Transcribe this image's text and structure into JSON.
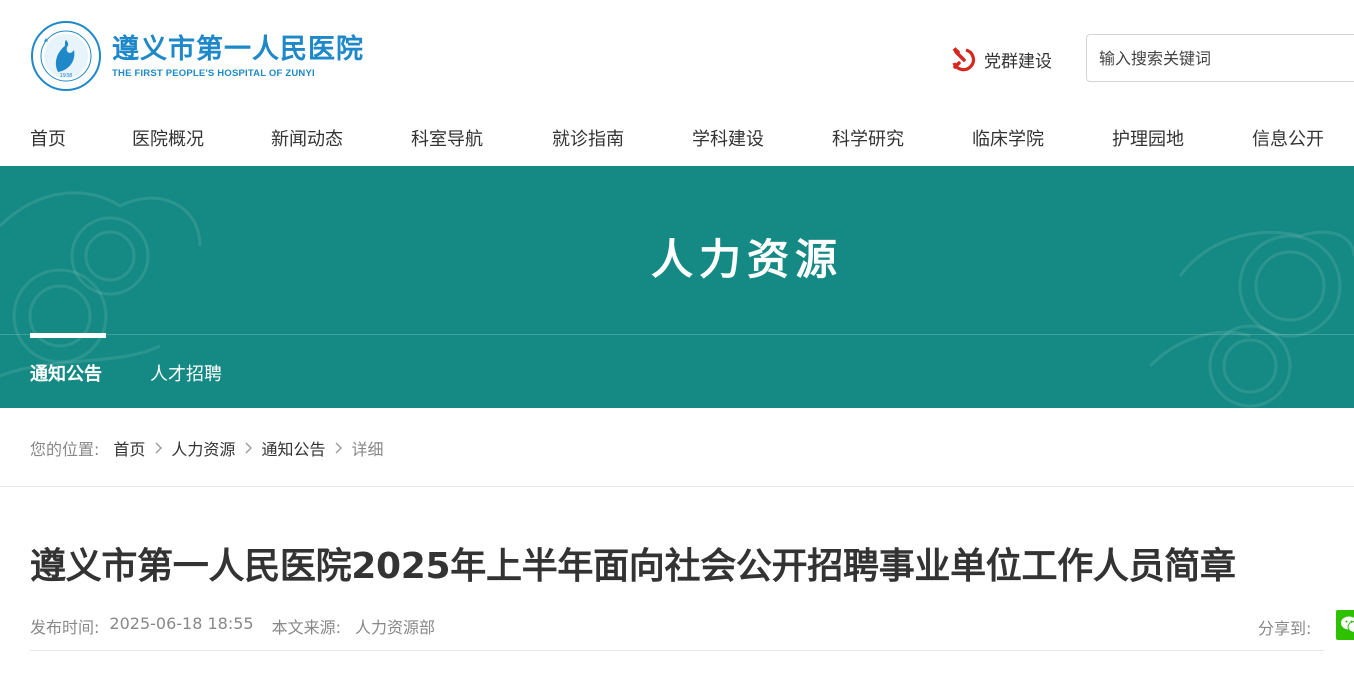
{
  "header": {
    "logo_cn": "遵义市第一人民医院",
    "logo_en": "THE FIRST PEOPLE'S HOSPITAL OF ZUNYI",
    "party_link": "党群建设",
    "search_placeholder": "输入搜索关键词"
  },
  "nav": {
    "items": [
      "首页",
      "医院概况",
      "新闻动态",
      "科室导航",
      "就诊指南",
      "学科建设",
      "科学研究",
      "临床学院",
      "护理园地",
      "信息公开"
    ]
  },
  "banner": {
    "title": "人力资源",
    "tabs": [
      {
        "label": "通知公告",
        "active": true
      },
      {
        "label": "人才招聘",
        "active": false
      }
    ],
    "background_color": "#158a84"
  },
  "breadcrumb": {
    "prefix": "您的位置:",
    "items": [
      "首页",
      "人力资源",
      "通知公告"
    ],
    "current": "详细"
  },
  "article": {
    "title": "遵义市第一人民医院2025年上半年面向社会公开招聘事业单位工作人员简章",
    "publish_label": "发布时间:",
    "publish_time": "2025-06-18 18:55",
    "source_label": "本文来源:",
    "source": "人力资源部",
    "share_label": "分享到:"
  },
  "icons": {
    "logo": "hospital-emblem",
    "party": "hammer-sickle-icon",
    "breadcrumb_sep": "chevron-right-icon",
    "share": "wechat-icon"
  }
}
